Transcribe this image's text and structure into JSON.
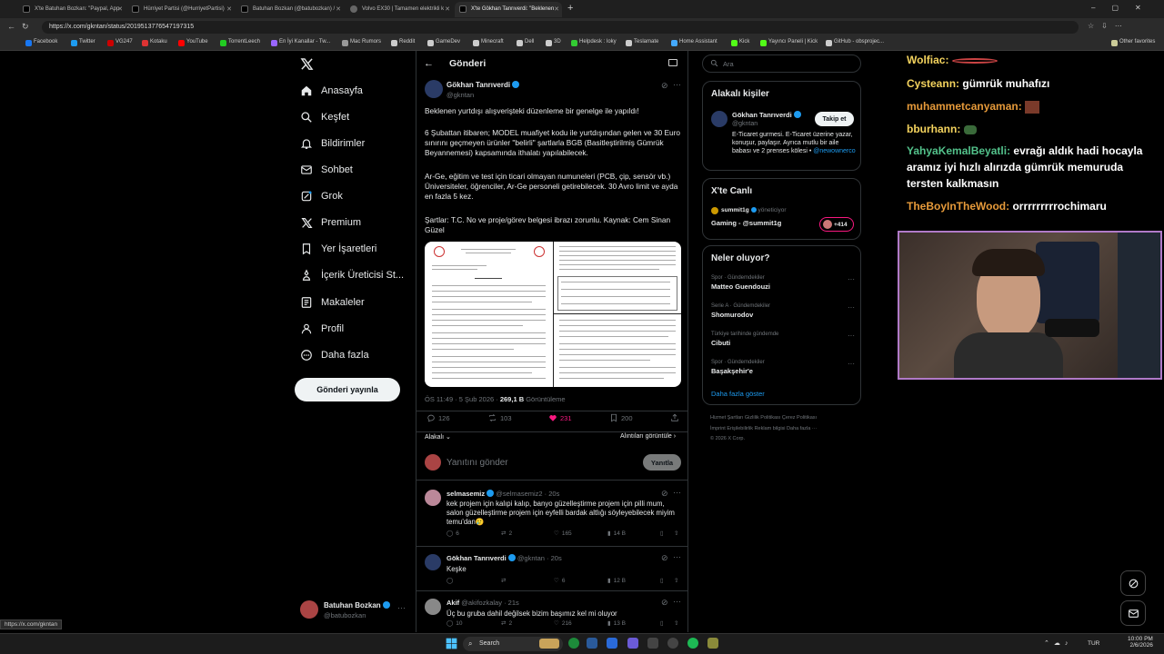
{
  "browser": {
    "tabs": [
      {
        "label": "X'te Batuhan Bozkan: \"Paypal, App"
      },
      {
        "label": "Hürriyet Partisi (@HurriyetPartisi)"
      },
      {
        "label": "Batuhan Bozkan (@batubozkan) /"
      },
      {
        "label": "Volvo EX30 | Tamamen elektrikli k"
      },
      {
        "label": "X'te Gökhan Tanrıverdi: \"Beklenen"
      }
    ],
    "url": "https://x.com/gkntan/status/2019513776547197315",
    "bookmarks": [
      "Facebook",
      "Twitter",
      "VG247",
      "Kotaku",
      "YouTube",
      "TorrentLeech",
      "En İyi Kanallar - Tw...",
      "Mac Rumors",
      "Reddit",
      "GameDev",
      "Minecraft",
      "Dell",
      "3D",
      "Helpdesk : loky",
      "Teslamate",
      "Home Assistant",
      "Kick",
      "Yayıncı Paneli | Kick",
      "GitHub - obsprojec..."
    ],
    "other_favorites": "Other favorites",
    "status_url": "https://x.com/gkntan"
  },
  "nav": {
    "items": [
      "Anasayfa",
      "Keşfet",
      "Bildirimler",
      "Sohbet",
      "Grok",
      "Premium",
      "Yer İşaretleri",
      "İçerik Üreticisi St...",
      "Makaleler",
      "Profil",
      "Daha fazla"
    ],
    "post_button": "Gönderi yayınla",
    "account_name": "Batuhan Bozkan",
    "account_handle": "@batubozkan"
  },
  "post": {
    "header": "Gönderi",
    "author_name": "Gökhan Tanrıverdi",
    "author_handle": "@gkntan",
    "paragraphs": [
      "Beklenen yurtdışı alışverişteki düzenleme bir genelge ile yapıldı!",
      "6 Şubattan itibaren; MODEL muafiyet kodu ile yurtdışından gelen ve 30 Euro sınırını geçmeyen ürünler \"belirli\" şartlarla BGB (Basitleştirilmiş Gümrük Beyannemesi) kapsamında ithalatı yapılabilecek.",
      "Ar-Ge, eğitim ve test için ticari olmayan numuneleri (PCB, çip, sensör vb.) Üniversiteler, öğrenciler, Ar-Ge personeli getirebilecek. 30 Avro limit ve ayda en fazla 5 kez.",
      "Şartlar: T.C. No ve proje/görev belgesi ibrazı zorunlu. Kaynak: Cem Sinan Güzel"
    ],
    "time": "ÖS 11:49 · 5 Şub 2026 · ",
    "views_count": "269,1 B",
    "views_label": " Görüntüleme",
    "replies": "126",
    "reposts": "103",
    "likes": "231",
    "bookmarks": "200",
    "relevant_label": "Alakalı",
    "view_quotes": "Alıntıları görüntüle",
    "reply_placeholder": "Yanıtını gönder",
    "reply_button": "Yanıtla"
  },
  "replies": [
    {
      "name": "selmasemiz",
      "handle": "@selmasemiz2 · 20s",
      "text": "kek projem için kalıpi kalıp, banyo güzelleştirme projem için pilli mum, salon güzelleştirme projem için eyfelli bardak altlığı söyleyebilecek miyim temu'dan🥲",
      "replies": "6",
      "reposts": "2",
      "likes": "165",
      "views": "14 B"
    },
    {
      "name": "Gökhan Tanrıverdi",
      "handle": "@gkntan · 20s",
      "text": "Keşke",
      "replies": "",
      "reposts": "",
      "likes": "6",
      "views": "12 B"
    },
    {
      "name": "Akif",
      "handle": "@akifozkalay · 21s",
      "text": "Üç bu gruba dahil değilsek bizim başımız kel mi oluyor",
      "replies": "10",
      "reposts": "2",
      "likes": "216",
      "views": "13 B"
    }
  ],
  "right": {
    "search_placeholder": "Ara",
    "related_title": "Alakalı kişiler",
    "person_name": "Gökhan Tanrıverdi",
    "person_handle": "@gkntan",
    "follow_button": "Takip et",
    "person_bio": "E-Ticaret gurmesi. E-Ticaret üzerine yazar, konuşur, paylaşır. Ayrıca mutlu bir aile babası ve 2 prenses kölesi •",
    "person_link": "@newownerco",
    "live_title": "X'te Canlı",
    "live_user": "summit1g",
    "live_status": "yöneticiyor",
    "live_text": "Gaming - @summit1g",
    "live_count": "+414",
    "trends_title": "Neler oluyor?",
    "trends": [
      {
        "context": "Spor · Gündemdekiler",
        "name": "Matteo Guendouzi"
      },
      {
        "context": "Serie A · Gündemdekiler",
        "name": "Shomurodov"
      },
      {
        "context": "Türkiye tarihinde gündemde",
        "name": "Cibuti"
      },
      {
        "context": "Spor · Gündemdekiler",
        "name": "Başakşehir'e"
      }
    ],
    "show_more": "Daha fazla göster",
    "footer1": "Hizmet Şartları   Gizlilik Politikası   Çerez Politikası",
    "footer2": "İmprint   Erişilebilirlik   Reklam bilgisi   Daha fazla ···",
    "footer3": "© 2026 X Corp."
  },
  "chat": [
    {
      "user": "Wolfiac:",
      "msg": "",
      "color": "#f4d35e"
    },
    {
      "user": "Cysteann:",
      "msg": "gümrük muhafızı",
      "color": "#f4d35e"
    },
    {
      "user": "muhammetcanyaman:",
      "msg": "",
      "color": "#e69a3a"
    },
    {
      "user": "bburhann:",
      "msg": "",
      "color": "#f4d35e"
    },
    {
      "user": "YahyaKemalBeyatli:",
      "msg": "evrağı aldık hadi hocayla aramız iyi hızlı alırızda gümrük memuruda tersten kalkmasın",
      "color": "#53c28b"
    },
    {
      "user": "TheBoyInTheWood:",
      "msg": "orrrrrrrrrochimaru",
      "color": "#e69a3a"
    }
  ],
  "taskbar": {
    "search": "Search",
    "lang": "TUR",
    "time": "10:00 PM",
    "date": "2/6/2026"
  },
  "colors": {
    "accent": "#1d9bf0",
    "like": "#f91880",
    "bg": "#000000"
  }
}
